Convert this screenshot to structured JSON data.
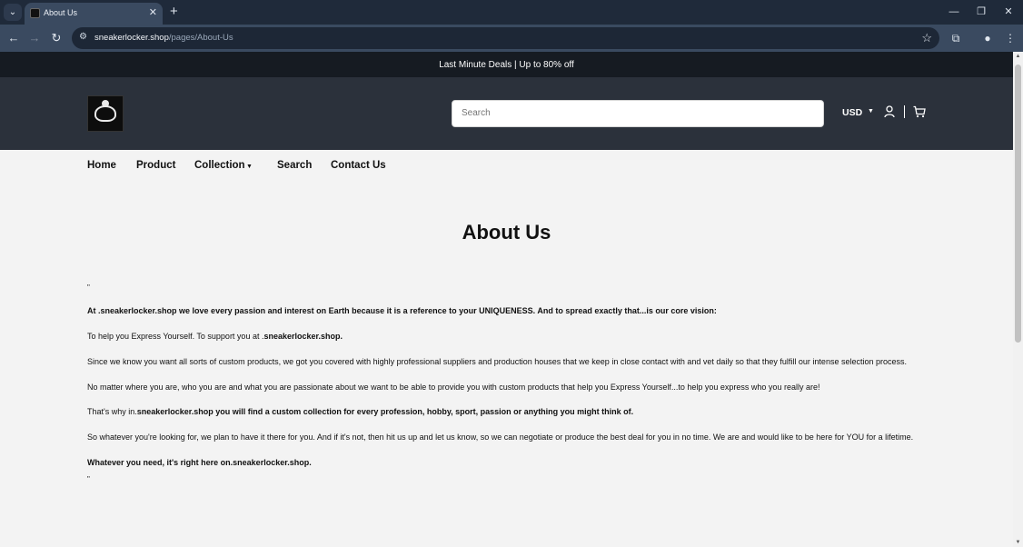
{
  "browser": {
    "tab_title": "About Us",
    "url_domain": "sneakerlocker.shop",
    "url_path": "/pages/About-Us"
  },
  "announcement": "Last Minute Deals | Up to 80% off",
  "header": {
    "search_placeholder": "Search",
    "currency": "USD"
  },
  "nav": {
    "home": "Home",
    "product": "Product",
    "collection": "Collection",
    "search": "Search",
    "contact": "Contact Us"
  },
  "content": {
    "title": "About Us",
    "quote_open": "\"",
    "quote_close": "\"",
    "p1": "At .sneakerlocker.shop we love every passion and interest on Earth because it is a reference to your UNIQUENESS. And to spread exactly that...is our core vision:",
    "p2_a": "To help you Express Yourself. To support you at .",
    "p2_b": "sneakerlocker.shop.",
    "p3": "Since we know you want all sorts of custom products, we got you covered with highly professional suppliers and production houses that we keep in close contact with and vet daily so that they fulfill our intense selection process.",
    "p4": "No matter where you are, who you are and what you are passionate about we want to be able to provide you with custom products that help you Express Yourself...to help you express who you really are!",
    "p5_a": "That's why in.",
    "p5_b": "sneakerlocker.shop you will find a custom collection for every profession, hobby, sport, passion or anything you might think of.",
    "p6": "So whatever you're looking for, we plan to have it there for you. And if it's not, then hit us up and let us know, so we can negotiate or produce the best deal for you in no time. We are and would like to be here for YOU for a lifetime.",
    "p7": "Whatever you need, it's right here on.sneakerlocker.shop."
  },
  "colors": {
    "announcement_bg": "#161b22",
    "header_bg": "#2b313b",
    "page_bg": "#f3f3f3"
  }
}
